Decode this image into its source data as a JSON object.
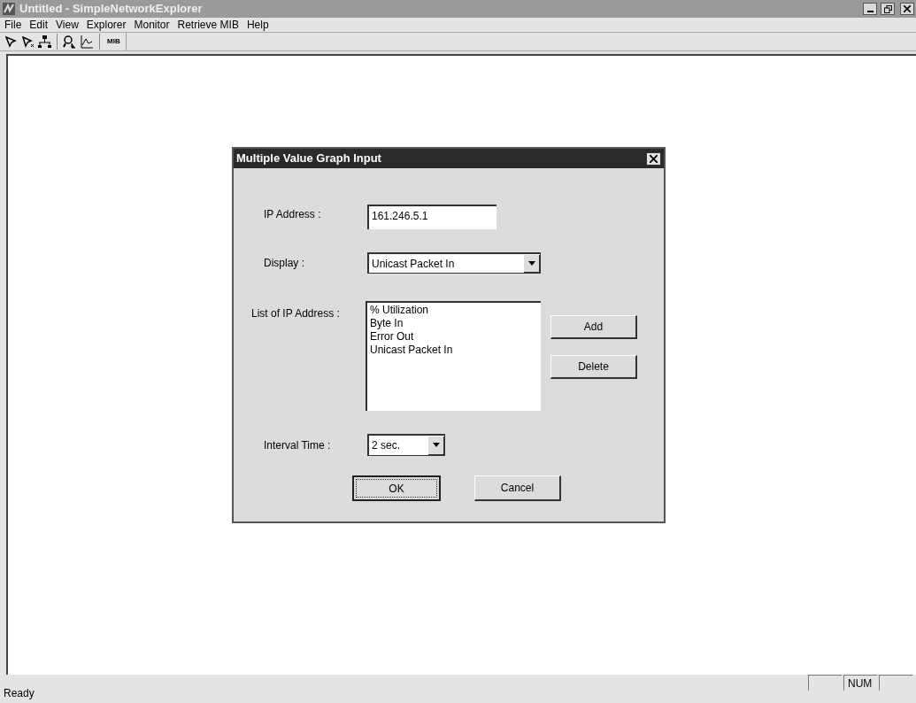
{
  "window": {
    "title": "Untitled - SimpleNetworkExplorer"
  },
  "menu": [
    "File",
    "Edit",
    "View",
    "Explorer",
    "Monitor",
    "Retrieve MIB",
    "Help"
  ],
  "toolbar": [
    {
      "kind": "pointer"
    },
    {
      "kind": "pointer-star"
    },
    {
      "kind": "network"
    },
    {
      "kind": "separator"
    },
    {
      "kind": "search"
    },
    {
      "kind": "graph"
    },
    {
      "kind": "separator"
    },
    {
      "kind": "text",
      "label": "MIB"
    }
  ],
  "dialog": {
    "title": "Multiple Value Graph Input",
    "ip_address": {
      "label": "IP Address :",
      "value": "161.246.5.1"
    },
    "display": {
      "label": "Display :",
      "value": "Unicast Packet In"
    },
    "list": {
      "label": "List of IP Address :",
      "items": [
        "% Utilization",
        "Byte In",
        "Error Out",
        "Unicast Packet In"
      ]
    },
    "side_buttons": [
      "Add",
      "Delete"
    ],
    "interval": {
      "label": "Interval Time :",
      "value": "2 sec."
    },
    "buttons": [
      {
        "label": "OK",
        "default": true
      },
      {
        "label": "Cancel",
        "default": false
      }
    ]
  },
  "status_bar": {
    "text": "Ready",
    "panels": [
      {
        "kind": "blank"
      },
      {
        "kind": "text",
        "text": "NUM"
      },
      {
        "kind": "blank"
      }
    ]
  }
}
